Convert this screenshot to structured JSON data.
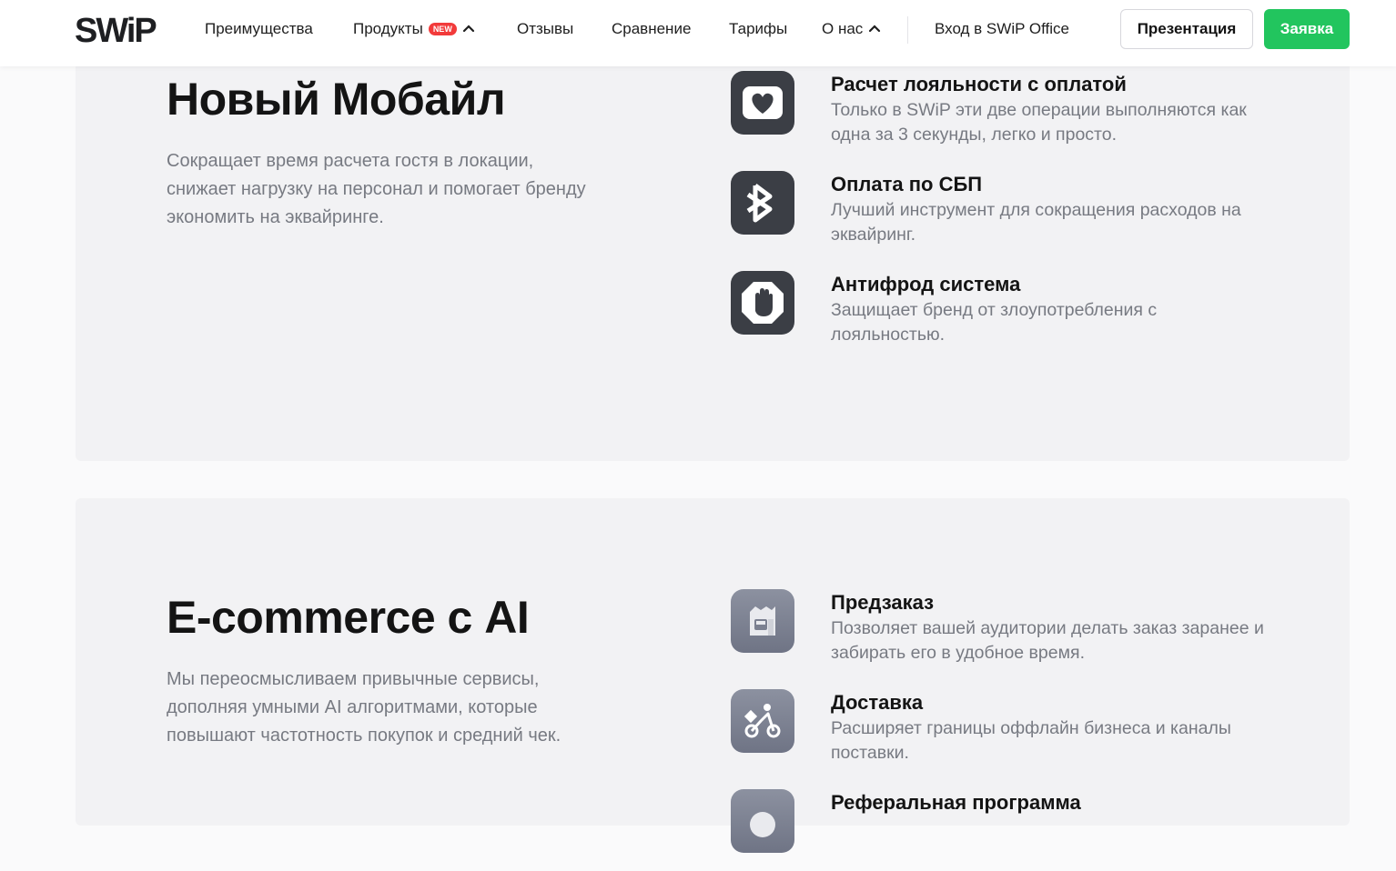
{
  "header": {
    "logo_text": "SWiP",
    "nav": [
      {
        "label": "Преимущества"
      },
      {
        "label": "Продукты",
        "badge": "NEW"
      },
      {
        "label": "Отзывы"
      },
      {
        "label": "Сравнение"
      },
      {
        "label": "Тарифы"
      },
      {
        "label": "О нас"
      }
    ],
    "office_link": "Вход в SWiP Office",
    "presentation_button": "Презентация",
    "apply_button": "Заявка",
    "accent_color": "#22c55e",
    "badge_color": "#f23b3b"
  },
  "sections": [
    {
      "title": "Новый Мобайл",
      "description": "Сокращает время расчета гостя в локации, снижает нагрузку на персонал и помогает бренду экономить на эквайринге.",
      "features": [
        {
          "icon": "heart-card-icon",
          "title": "Расчет лояльности с оплатой",
          "description": "Только в SWiP эти две операции выполняются как одна за 3 секунды, легко и просто."
        },
        {
          "icon": "sbp-icon",
          "title": "Оплата по СБП",
          "description": "Лучший инструмент для сокращения расходов на эквайринг."
        },
        {
          "icon": "stop-hand-icon",
          "title": "Антифрод система",
          "description": "Защищает бренд от злоупотребления с лояльностью."
        }
      ]
    },
    {
      "title": "E-commerce с AI",
      "description": "Мы переосмысливаем привычные сервисы, дополняя умными AI алгоритмами, которые повышают частотность покупок и средний чек.",
      "features": [
        {
          "icon": "store-icon",
          "title": "Предзаказ",
          "description": "Позволяет вашей аудитории делать заказ заранее и забирать его в удобное время."
        },
        {
          "icon": "courier-bike-icon",
          "title": "Доставка",
          "description": "Расширяет границы оффлайн бизнеса и каналы поставки."
        },
        {
          "icon": "referral-icon",
          "title": "Реферальная программа",
          "description": ""
        }
      ]
    }
  ]
}
